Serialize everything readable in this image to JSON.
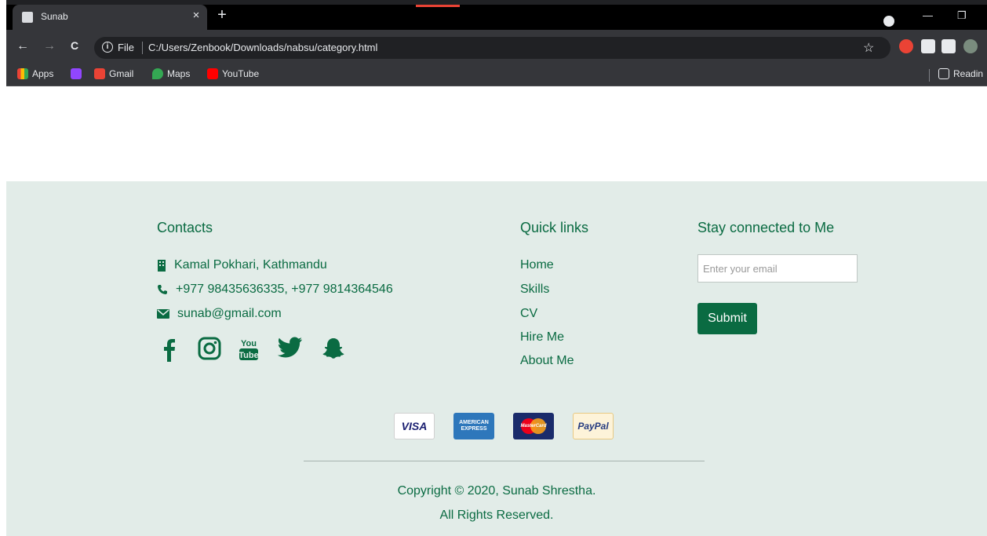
{
  "browser": {
    "tab_title": "Sunab",
    "tab_close_glyph": "×",
    "new_tab_glyph": "+",
    "minimize_glyph": "—",
    "restore_glyph": "❐",
    "back_glyph": "←",
    "forward_glyph": "→",
    "reload_glyph": "C",
    "info_glyph": "i",
    "file_label": "File",
    "url": "C:/Users/Zenbook/Downloads/nabsu/category.html",
    "star_glyph": "☆",
    "bookmarks": [
      {
        "label": "Apps",
        "icon": "apps-grid-icon"
      },
      {
        "label": "",
        "icon": "twitch-icon"
      },
      {
        "label": "Gmail",
        "icon": "gmail-icon"
      },
      {
        "label": "Maps",
        "icon": "maps-icon"
      },
      {
        "label": "YouTube",
        "icon": "youtube-icon"
      }
    ],
    "reading_list_label": "Readin"
  },
  "footer": {
    "contacts": {
      "title": "Contacts",
      "address": "Kamal Pokhari, Kathmandu",
      "phone": "+977 98435636335, +977 9814364546",
      "email": "sunab@gmail.com"
    },
    "social": [
      {
        "name": "facebook-icon",
        "glyph": "f"
      },
      {
        "name": "instagram-icon",
        "glyph": ""
      },
      {
        "name": "youtube-icon",
        "glyph": "You Tube"
      },
      {
        "name": "twitter-icon",
        "glyph": ""
      },
      {
        "name": "snapchat-icon",
        "glyph": ""
      }
    ],
    "quick_links": {
      "title": "Quick links",
      "items": [
        "Home",
        "Skills",
        "CV",
        "Hire Me",
        "About Me"
      ]
    },
    "newsletter": {
      "title": "Stay connected to Me",
      "placeholder": "Enter your email",
      "submit_label": "Submit"
    },
    "payments": [
      {
        "name": "visa-card",
        "label": "VISA"
      },
      {
        "name": "amex-card",
        "label": "AMERICAN EXPRESS"
      },
      {
        "name": "mastercard-card",
        "label": "MasterCard"
      },
      {
        "name": "paypal-card",
        "label": "PayPal"
      }
    ],
    "copyright_line1": "Copyright © 2020, Sunab Shrestha.",
    "copyright_line2": "All Rights Reserved."
  },
  "colors": {
    "brand_green": "#0a6b42",
    "footer_bg": "#e2ece8",
    "chrome_bg": "#35363a"
  }
}
